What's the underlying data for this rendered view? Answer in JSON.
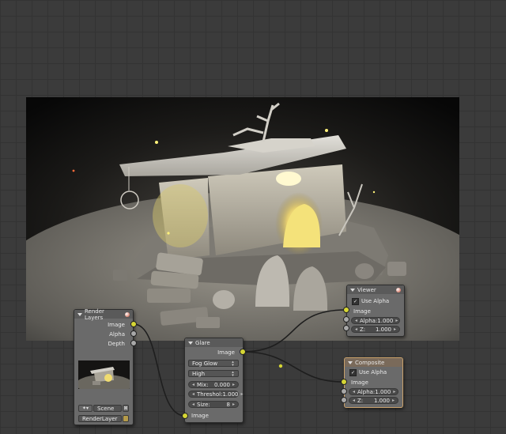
{
  "render_layers": {
    "title": "Render Layers",
    "outputs": [
      "Image",
      "Alpha",
      "Depth"
    ],
    "scene_value": "Scene",
    "layer_value": "RenderLayer"
  },
  "glare": {
    "title": "Glare",
    "output": "Image",
    "glare_type": "Fog Glow",
    "quality": "High",
    "mix_label": "Mix:",
    "mix_value": "0.000",
    "threshold_label": "Threshol:",
    "threshold_value": "1.000",
    "size_label": "Size:",
    "size_value": "8",
    "input": "Image"
  },
  "viewer": {
    "title": "Viewer",
    "use_alpha_label": "Use Alpha",
    "use_alpha": true,
    "input_image": "Image",
    "alpha_label": "Alpha:",
    "alpha_value": "1.000",
    "z_label": "Z:",
    "z_value": "1.000"
  },
  "composite": {
    "title": "Composite",
    "use_alpha_label": "Use Alpha",
    "use_alpha": true,
    "input_image": "Image",
    "alpha_label": "Alpha:",
    "alpha_value": "1.000",
    "z_label": "Z:",
    "z_value": "1.000"
  },
  "colors": {
    "socket_color": "#d6d635",
    "value_socket": "#a8a8a8",
    "editor_bg": "#3b3b3b",
    "node_bg": "#6a6a6a"
  },
  "icons": [
    "node-collapse-icon",
    "node-preview-ball-icon",
    "scene-icon",
    "render-layer-icon"
  ]
}
